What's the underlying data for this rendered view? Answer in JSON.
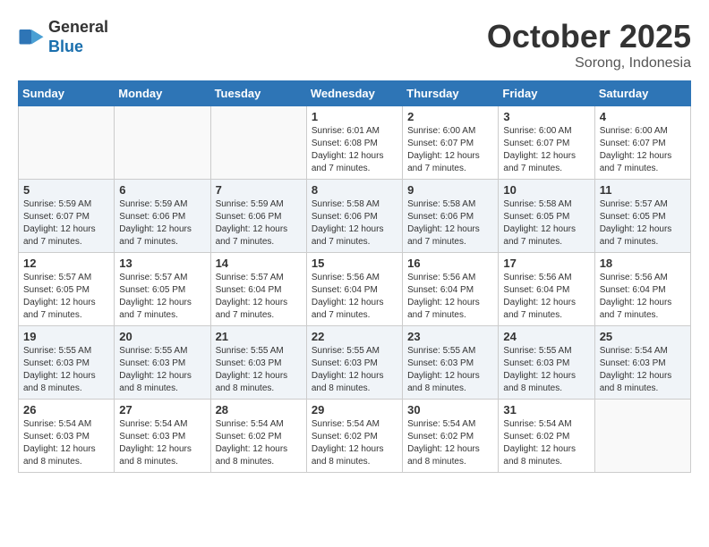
{
  "header": {
    "logo_line1": "General",
    "logo_line2": "Blue",
    "month": "October 2025",
    "location": "Sorong, Indonesia"
  },
  "days_of_week": [
    "Sunday",
    "Monday",
    "Tuesday",
    "Wednesday",
    "Thursday",
    "Friday",
    "Saturday"
  ],
  "weeks": [
    [
      {
        "day": "",
        "info": ""
      },
      {
        "day": "",
        "info": ""
      },
      {
        "day": "",
        "info": ""
      },
      {
        "day": "1",
        "info": "Sunrise: 6:01 AM\nSunset: 6:08 PM\nDaylight: 12 hours and 7 minutes."
      },
      {
        "day": "2",
        "info": "Sunrise: 6:00 AM\nSunset: 6:07 PM\nDaylight: 12 hours and 7 minutes."
      },
      {
        "day": "3",
        "info": "Sunrise: 6:00 AM\nSunset: 6:07 PM\nDaylight: 12 hours and 7 minutes."
      },
      {
        "day": "4",
        "info": "Sunrise: 6:00 AM\nSunset: 6:07 PM\nDaylight: 12 hours and 7 minutes."
      }
    ],
    [
      {
        "day": "5",
        "info": "Sunrise: 5:59 AM\nSunset: 6:07 PM\nDaylight: 12 hours and 7 minutes."
      },
      {
        "day": "6",
        "info": "Sunrise: 5:59 AM\nSunset: 6:06 PM\nDaylight: 12 hours and 7 minutes."
      },
      {
        "day": "7",
        "info": "Sunrise: 5:59 AM\nSunset: 6:06 PM\nDaylight: 12 hours and 7 minutes."
      },
      {
        "day": "8",
        "info": "Sunrise: 5:58 AM\nSunset: 6:06 PM\nDaylight: 12 hours and 7 minutes."
      },
      {
        "day": "9",
        "info": "Sunrise: 5:58 AM\nSunset: 6:06 PM\nDaylight: 12 hours and 7 minutes."
      },
      {
        "day": "10",
        "info": "Sunrise: 5:58 AM\nSunset: 6:05 PM\nDaylight: 12 hours and 7 minutes."
      },
      {
        "day": "11",
        "info": "Sunrise: 5:57 AM\nSunset: 6:05 PM\nDaylight: 12 hours and 7 minutes."
      }
    ],
    [
      {
        "day": "12",
        "info": "Sunrise: 5:57 AM\nSunset: 6:05 PM\nDaylight: 12 hours and 7 minutes."
      },
      {
        "day": "13",
        "info": "Sunrise: 5:57 AM\nSunset: 6:05 PM\nDaylight: 12 hours and 7 minutes."
      },
      {
        "day": "14",
        "info": "Sunrise: 5:57 AM\nSunset: 6:04 PM\nDaylight: 12 hours and 7 minutes."
      },
      {
        "day": "15",
        "info": "Sunrise: 5:56 AM\nSunset: 6:04 PM\nDaylight: 12 hours and 7 minutes."
      },
      {
        "day": "16",
        "info": "Sunrise: 5:56 AM\nSunset: 6:04 PM\nDaylight: 12 hours and 7 minutes."
      },
      {
        "day": "17",
        "info": "Sunrise: 5:56 AM\nSunset: 6:04 PM\nDaylight: 12 hours and 7 minutes."
      },
      {
        "day": "18",
        "info": "Sunrise: 5:56 AM\nSunset: 6:04 PM\nDaylight: 12 hours and 7 minutes."
      }
    ],
    [
      {
        "day": "19",
        "info": "Sunrise: 5:55 AM\nSunset: 6:03 PM\nDaylight: 12 hours and 8 minutes."
      },
      {
        "day": "20",
        "info": "Sunrise: 5:55 AM\nSunset: 6:03 PM\nDaylight: 12 hours and 8 minutes."
      },
      {
        "day": "21",
        "info": "Sunrise: 5:55 AM\nSunset: 6:03 PM\nDaylight: 12 hours and 8 minutes."
      },
      {
        "day": "22",
        "info": "Sunrise: 5:55 AM\nSunset: 6:03 PM\nDaylight: 12 hours and 8 minutes."
      },
      {
        "day": "23",
        "info": "Sunrise: 5:55 AM\nSunset: 6:03 PM\nDaylight: 12 hours and 8 minutes."
      },
      {
        "day": "24",
        "info": "Sunrise: 5:55 AM\nSunset: 6:03 PM\nDaylight: 12 hours and 8 minutes."
      },
      {
        "day": "25",
        "info": "Sunrise: 5:54 AM\nSunset: 6:03 PM\nDaylight: 12 hours and 8 minutes."
      }
    ],
    [
      {
        "day": "26",
        "info": "Sunrise: 5:54 AM\nSunset: 6:03 PM\nDaylight: 12 hours and 8 minutes."
      },
      {
        "day": "27",
        "info": "Sunrise: 5:54 AM\nSunset: 6:03 PM\nDaylight: 12 hours and 8 minutes."
      },
      {
        "day": "28",
        "info": "Sunrise: 5:54 AM\nSunset: 6:02 PM\nDaylight: 12 hours and 8 minutes."
      },
      {
        "day": "29",
        "info": "Sunrise: 5:54 AM\nSunset: 6:02 PM\nDaylight: 12 hours and 8 minutes."
      },
      {
        "day": "30",
        "info": "Sunrise: 5:54 AM\nSunset: 6:02 PM\nDaylight: 12 hours and 8 minutes."
      },
      {
        "day": "31",
        "info": "Sunrise: 5:54 AM\nSunset: 6:02 PM\nDaylight: 12 hours and 8 minutes."
      },
      {
        "day": "",
        "info": ""
      }
    ]
  ]
}
